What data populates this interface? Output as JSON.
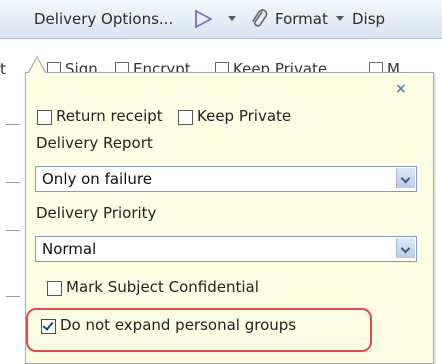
{
  "toolbar": {
    "delivery_options_label": "Delivery Options...",
    "format_label": "Format",
    "display_label": "Disp",
    "flag_icon": "flag-icon",
    "attachment_icon": "paperclip-icon"
  },
  "background_strip": {
    "items": [
      "Sign",
      "Encrypt",
      "Keep Private",
      "M"
    ],
    "leading_fragment": "t"
  },
  "popup": {
    "close_symbol": "×",
    "return_receipt_label": "Return receipt",
    "keep_private_label": "Keep Private",
    "delivery_report_label": "Delivery Report",
    "delivery_report_value": "Only on failure",
    "delivery_priority_label": "Delivery Priority",
    "delivery_priority_value": "Normal",
    "mark_confidential_label": "Mark Subject Confidential",
    "no_expand_groups_label": "Do not expand personal groups"
  },
  "colors": {
    "popup_bg": "#fdfde3",
    "highlight": "#e5484d",
    "toolbar_gradient_top": "#f3f7fc",
    "toolbar_gradient_bottom": "#d9e4f1"
  }
}
